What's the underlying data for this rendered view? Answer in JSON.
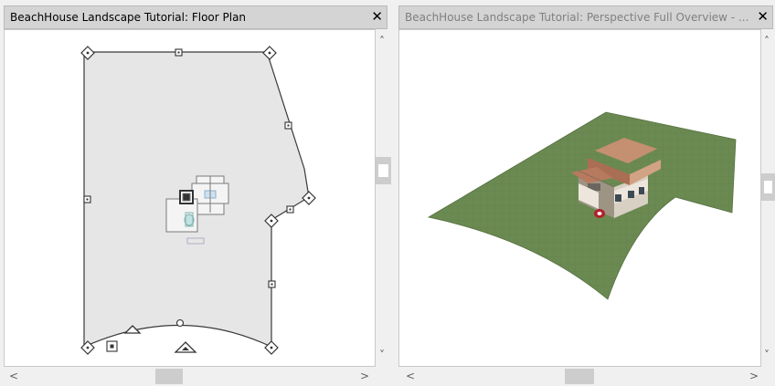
{
  "left_panel": {
    "title": "BeachHouse Landscape Tutorial: Floor Plan",
    "close_glyph": "✕"
  },
  "right_panel": {
    "title": "BeachHouse Landscape Tutorial: Perspective Full Overview - ...",
    "close_glyph": "✕"
  },
  "scroll_glyphs": {
    "up": "˄",
    "down": "˅",
    "left": "<",
    "right": ">"
  },
  "colors": {
    "terrain_green": "#6b8a52",
    "plan_fill": "#e6e6e6",
    "plan_line": "#3a3a3a",
    "roof": "#c08a6a"
  },
  "icons": [
    "close-icon",
    "scroll-up-icon",
    "scroll-down-icon",
    "scroll-left-icon",
    "scroll-right-icon"
  ]
}
